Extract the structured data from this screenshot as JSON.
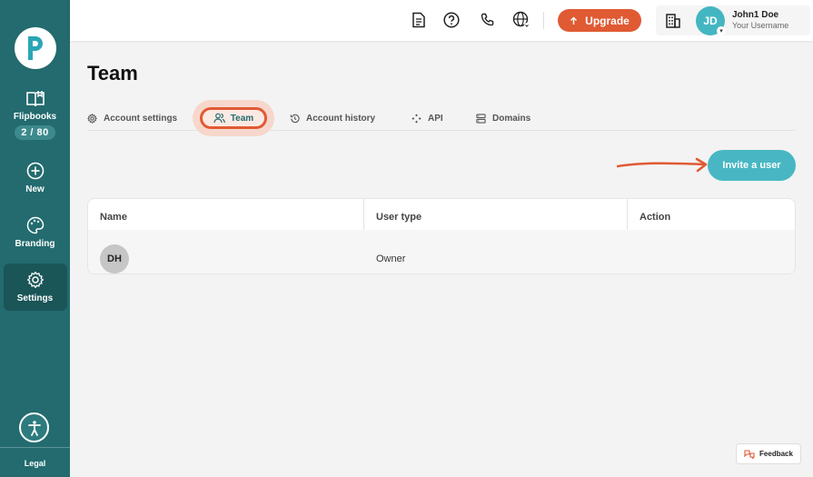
{
  "sidebar": {
    "items": [
      {
        "label": "Flipbooks",
        "counter": "2 / 80"
      },
      {
        "label": "New"
      },
      {
        "label": "Branding"
      },
      {
        "label": "Settings"
      }
    ],
    "legal": "Legal"
  },
  "topbar": {
    "upgrade_label": "Upgrade",
    "user_name": "John1 Doe",
    "user_sub": "Your Username",
    "user_initials": "JD"
  },
  "page": {
    "title": "Team",
    "tabs": [
      {
        "label": "Account settings",
        "icon": "gear-icon"
      },
      {
        "label": "Team",
        "icon": "users-icon"
      },
      {
        "label": "Account history",
        "icon": "history-icon"
      },
      {
        "label": "API",
        "icon": "api-icon"
      },
      {
        "label": "Domains",
        "icon": "server-icon"
      }
    ],
    "invite_label": "Invite a user"
  },
  "table": {
    "columns": [
      "Name",
      "User type",
      "Action"
    ],
    "rows": [
      {
        "initials": "DH",
        "user_type": "Owner",
        "action": ""
      }
    ]
  },
  "feedback_label": "Feedback",
  "colors": {
    "sidebar": "#236b6e",
    "accent_orange": "#e05a33",
    "accent_teal": "#48b7c3"
  }
}
